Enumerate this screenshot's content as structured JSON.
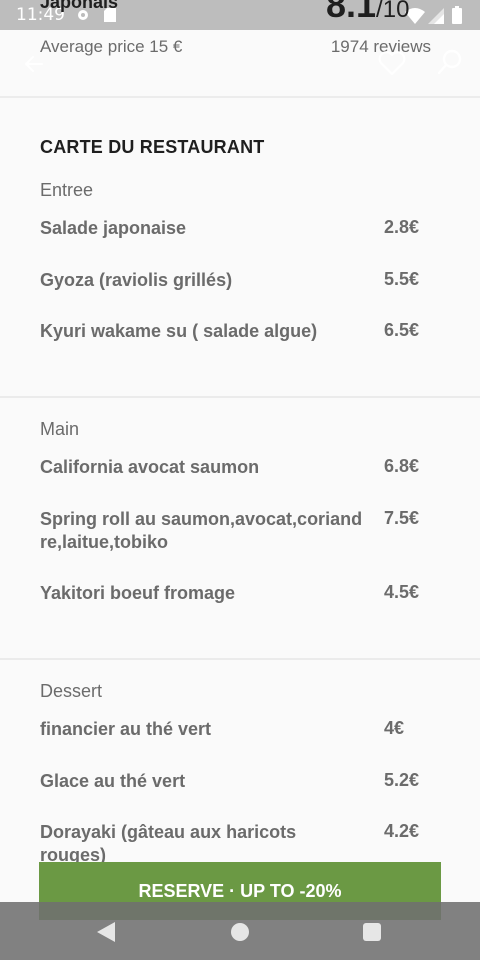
{
  "status_bar": {
    "time": "11:49",
    "icons": [
      "gear-icon",
      "sd-card-icon",
      "wifi-icon",
      "signal-icon",
      "battery-icon"
    ]
  },
  "header": {
    "partial_name": "Japonais",
    "rating_value": "8.1",
    "rating_scale": "/10",
    "average_price": "Average price 15 €",
    "reviews": "1974 reviews",
    "icons": [
      "back-arrow-icon",
      "heart-icon",
      "search-icon"
    ]
  },
  "menu": {
    "title": "CARTE DU RESTAURANT",
    "sections": [
      {
        "name": "Entree",
        "items": [
          {
            "name": "Salade japonaise",
            "price": "2.8€"
          },
          {
            "name": "Gyoza (raviolis grillés)",
            "price": "5.5€"
          },
          {
            "name": "Kyuri wakame su ( salade algue)",
            "price": "6.5€"
          }
        ]
      },
      {
        "name": "Main",
        "items": [
          {
            "name": "California avocat saumon",
            "price": "6.8€"
          },
          {
            "name": "Spring roll au saumon,avocat,coriandre,laitue,tobiko",
            "price": "7.5€"
          },
          {
            "name": "Yakitori boeuf fromage",
            "price": "4.5€"
          }
        ]
      },
      {
        "name": "Dessert",
        "items": [
          {
            "name": "financier au thé vert",
            "price": "4€"
          },
          {
            "name": "Glace au thé vert",
            "price": "5.2€"
          },
          {
            "name": "Dorayaki (gâteau aux haricots rouges)",
            "price": "4.2€"
          }
        ]
      }
    ]
  },
  "reserve_button": {
    "label": "RESERVE · UP TO -20%",
    "color": "#6b9944"
  },
  "nav_bar": {
    "icons": [
      "back-triangle-icon",
      "home-circle-icon",
      "recents-square-icon"
    ]
  }
}
